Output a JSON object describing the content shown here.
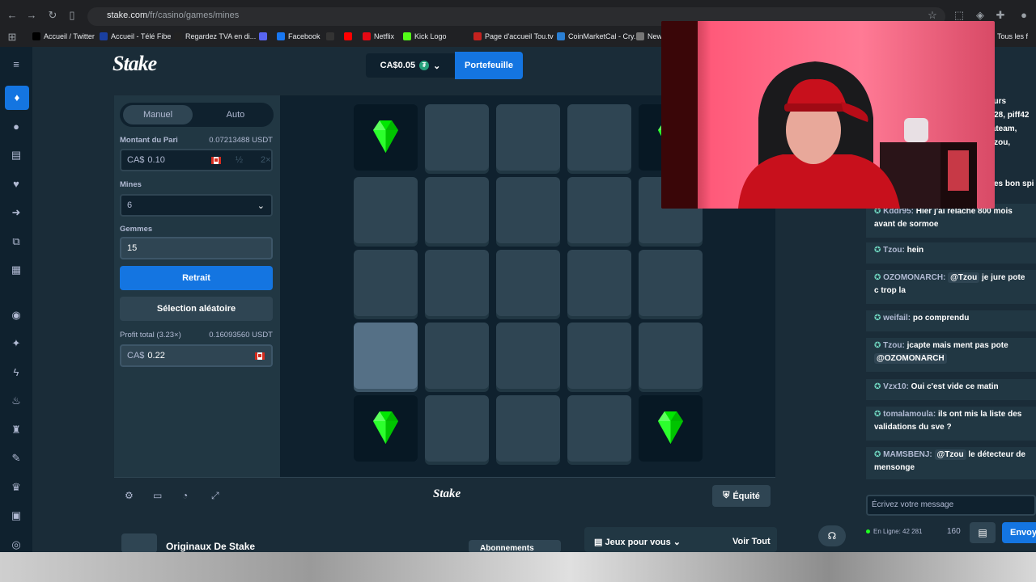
{
  "browser": {
    "url_host": "stake.com",
    "url_path": "/fr/casino/games/mines",
    "bookmarks": [
      {
        "label": "Accueil / Twitter",
        "color": "#000000"
      },
      {
        "label": "Accueil - Télé Fibe",
        "color": "#1a3fa0"
      },
      {
        "label": "Regardez TVA en di...",
        "color": "#222222"
      },
      {
        "label": "",
        "color": "#5865f2"
      },
      {
        "label": "Facebook",
        "color": "#1877f2"
      },
      {
        "label": "",
        "color": "#333333"
      },
      {
        "label": "",
        "color": "#ff0000"
      },
      {
        "label": "Netflix",
        "color": "#e50914"
      },
      {
        "label": "Kick Logo",
        "color": "#53fc18"
      },
      {
        "label": "Page d'accueil Tou.tv",
        "color": "#c5221f"
      },
      {
        "label": "CoinMarketCal - Cry...",
        "color": "#2a7fd4"
      },
      {
        "label": "New",
        "color": "#777777"
      }
    ],
    "bookmarks_right": "Tous les f"
  },
  "header": {
    "logo": "Stake",
    "balance": "CA$0.05",
    "wallet_label": "Portefeuille"
  },
  "panel": {
    "mode_manual": "Manuel",
    "mode_auto": "Auto",
    "bet_label": "Montant du Pari",
    "bet_crypto": "0.07213488 USDT",
    "bet_currency": "CA$",
    "bet_value": "0.10",
    "half_label": "½",
    "double_label": "2×",
    "mines_label": "Mines",
    "mines_value": "6",
    "gems_label": "Gemmes",
    "gems_value": "15",
    "cashout_label": "Retrait",
    "random_label": "Sélection aléatoire",
    "profit_label": "Profit total (3.23×)",
    "profit_crypto": "0.16093560 USDT",
    "profit_currency": "CA$",
    "profit_value": "0.22"
  },
  "board": {
    "grid": [
      [
        "gem",
        "hidden",
        "hidden",
        "hidden",
        "gem"
      ],
      [
        "hidden",
        "hidden",
        "hidden",
        "hidden",
        "hidden"
      ],
      [
        "hidden",
        "hidden",
        "hidden",
        "hidden",
        "hidden"
      ],
      [
        "selected",
        "hidden",
        "hidden",
        "hidden",
        "hidden"
      ],
      [
        "gem",
        "hidden",
        "hidden",
        "hidden",
        "gem"
      ]
    ],
    "gem_color": "#00e701"
  },
  "bottombar": {
    "logo": "Stake",
    "fairness_label": "Équité"
  },
  "lobby": {
    "originals": "Originaux De Stake",
    "subscriptions": "Abonnements",
    "games_for_you": "Jeux pour vous",
    "see_all": "Voir Tout"
  },
  "chat": {
    "partial_top": [
      "eurs",
      "o28, piff42",
      "iateam,",
      "Tzou,",
      "es bon spi"
    ],
    "messages": [
      {
        "user": "Kddr95:",
        "text": "Hier j'ai relâché 800 mois avant de sormoe"
      },
      {
        "user": "Tzou:",
        "text": "hein"
      },
      {
        "user": "OZOMONARCH:",
        "mention": "@Tzou",
        "text": "je jure pote c trop la"
      },
      {
        "user": "weifail:",
        "text": "po comprendu"
      },
      {
        "user": "Tzou:",
        "text": "jcapte mais ment pas pote",
        "mention2": "@OZOMONARCH"
      },
      {
        "user": "Vzx10:",
        "text": "Oui c'est vide ce matin"
      },
      {
        "user": "tomalamoula:",
        "text": "ils ont mis la liste des validations du sve ?"
      },
      {
        "user": "MAMSBENJ:",
        "mention": "@Tzou",
        "text": "le détecteur de mensonge"
      }
    ],
    "input_placeholder": "Écrivez votre message",
    "online_label": "En Ligne: 42 281",
    "count": "160",
    "send_label": "Envoy"
  },
  "colors": {
    "accent": "#1475e1",
    "bg_dark": "#0f212e",
    "bg_mid": "#1a2c38",
    "gem": "#00e701"
  }
}
